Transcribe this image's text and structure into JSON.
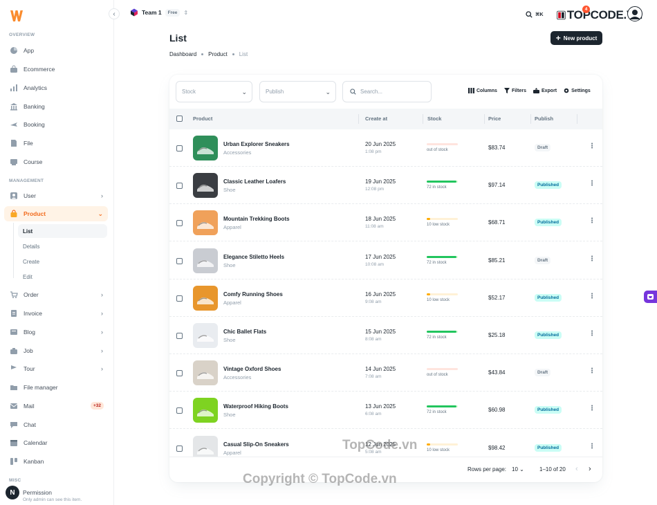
{
  "brand": {
    "accent": "#f26b1d",
    "primary_dark": "#1c252e"
  },
  "sidebar": {
    "overview_title": "OVERVIEW",
    "overview_items": [
      {
        "label": "App",
        "icon": "app-icon"
      },
      {
        "label": "Ecommerce",
        "icon": "bag-icon"
      },
      {
        "label": "Analytics",
        "icon": "analytics-icon"
      },
      {
        "label": "Banking",
        "icon": "bank-icon"
      },
      {
        "label": "Booking",
        "icon": "airplane-icon"
      },
      {
        "label": "File",
        "icon": "file-icon"
      },
      {
        "label": "Course",
        "icon": "course-icon"
      }
    ],
    "management_title": "MANAGEMENT",
    "user_label": "User",
    "product_label": "Product",
    "product_sub": [
      "List",
      "Details",
      "Create",
      "Edit"
    ],
    "management_items": [
      {
        "label": "Order",
        "icon": "cart-icon",
        "chevron": true
      },
      {
        "label": "Invoice",
        "icon": "invoice-icon",
        "chevron": true
      },
      {
        "label": "Blog",
        "icon": "blog-icon",
        "chevron": true
      },
      {
        "label": "Job",
        "icon": "job-icon",
        "chevron": true
      },
      {
        "label": "Tour",
        "icon": "tour-icon",
        "chevron": true
      },
      {
        "label": "File manager",
        "icon": "folder-icon",
        "chevron": false
      },
      {
        "label": "Mail",
        "icon": "mail-icon",
        "chevron": false
      },
      {
        "label": "Chat",
        "icon": "chat-icon",
        "chevron": false
      },
      {
        "label": "Calendar",
        "icon": "calendar-icon",
        "chevron": false
      },
      {
        "label": "Kanban",
        "icon": "kanban-icon",
        "chevron": false
      }
    ],
    "mail_badge": "+32",
    "misc_title": "MISC",
    "permission_label": "Permission",
    "permission_caption": "Only admin can see this item.",
    "avatar_letter": "N"
  },
  "topbar": {
    "team_name": "Team 1",
    "team_plan": "Free",
    "search_shortcut": "⌘K",
    "notification_count": "4",
    "watermark_logo_text": "TOPCODE.VN"
  },
  "header": {
    "title": "List",
    "breadcrumbs": [
      "Dashboard",
      "Product",
      "List"
    ],
    "new_button": "New product"
  },
  "filters": {
    "stock_placeholder": "Stock",
    "publish_placeholder": "Publish",
    "search_placeholder": "Search..."
  },
  "toolbar": {
    "columns": "Columns",
    "filters": "Filters",
    "export": "Export",
    "settings": "Settings"
  },
  "table": {
    "headers": {
      "product": "Product",
      "create_at": "Create at",
      "stock": "Stock",
      "price": "Price",
      "publish": "Publish"
    },
    "rows": [
      {
        "name": "Urban Explorer Sneakers",
        "category": "Accessories",
        "date": "20 Jun 2025",
        "time": "1:08 pm",
        "stock_level": 0,
        "stock_text": "out of stock",
        "stock_status": "out",
        "price": "$83.74",
        "publish": "Draft"
      },
      {
        "name": "Classic Leather Loafers",
        "category": "Shoe",
        "date": "19 Jun 2025",
        "time": "12:08 pm",
        "stock_level": 0.95,
        "stock_text": "72 in stock",
        "stock_status": "in",
        "price": "$97.14",
        "publish": "Published"
      },
      {
        "name": "Mountain Trekking Boots",
        "category": "Apparel",
        "date": "18 Jun 2025",
        "time": "11:08 am",
        "stock_level": 0.12,
        "stock_text": "10 low stock",
        "stock_status": "low",
        "price": "$68.71",
        "publish": "Published"
      },
      {
        "name": "Elegance Stiletto Heels",
        "category": "Shoe",
        "date": "17 Jun 2025",
        "time": "10:08 am",
        "stock_level": 0.95,
        "stock_text": "72 in stock",
        "stock_status": "in",
        "price": "$85.21",
        "publish": "Draft"
      },
      {
        "name": "Comfy Running Shoes",
        "category": "Apparel",
        "date": "16 Jun 2025",
        "time": "9:08 am",
        "stock_level": 0.12,
        "stock_text": "10 low stock",
        "stock_status": "low",
        "price": "$52.17",
        "publish": "Published"
      },
      {
        "name": "Chic Ballet Flats",
        "category": "Shoe",
        "date": "15 Jun 2025",
        "time": "8:08 am",
        "stock_level": 0.95,
        "stock_text": "72 in stock",
        "stock_status": "in",
        "price": "$25.18",
        "publish": "Published"
      },
      {
        "name": "Vintage Oxford Shoes",
        "category": "Accessories",
        "date": "14 Jun 2025",
        "time": "7:08 am",
        "stock_level": 0,
        "stock_text": "out of stock",
        "stock_status": "out",
        "price": "$43.84",
        "publish": "Draft"
      },
      {
        "name": "Waterproof Hiking Boots",
        "category": "Shoe",
        "date": "13 Jun 2025",
        "time": "6:08 am",
        "stock_level": 0.95,
        "stock_text": "72 in stock",
        "stock_status": "in",
        "price": "$60.98",
        "publish": "Published"
      },
      {
        "name": "Casual Slip-On Sneakers",
        "category": "Apparel",
        "date": "12 Jun 2025",
        "time": "5:08 am",
        "stock_level": 0.12,
        "stock_text": "10 low stock",
        "stock_status": "low",
        "price": "$98.42",
        "publish": "Published"
      }
    ],
    "thumb_colors": [
      "#2f8f5a",
      "#3a3d42",
      "#f0a15a",
      "#c9ccd2",
      "#e8962c",
      "#e9ecf0",
      "#d9d2c8",
      "#7ed321",
      "#e4e6e8"
    ]
  },
  "pagination": {
    "rows_per_page_label": "Rows per page:",
    "rows_per_page": "10",
    "range": "1–10 of 20"
  },
  "watermarks": {
    "center": "TopCode.vn",
    "bottom": "Copyright © TopCode.vn"
  }
}
